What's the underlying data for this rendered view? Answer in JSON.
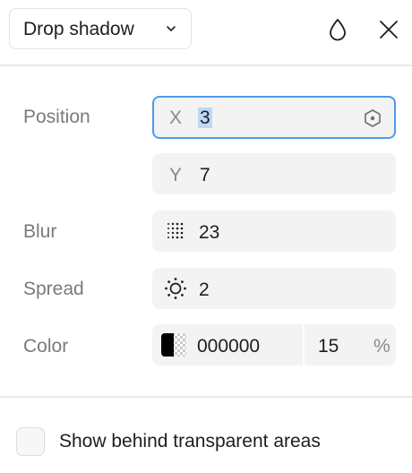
{
  "header": {
    "effect_type": "Drop shadow",
    "icons": {
      "dropdown": "chevron-down-icon",
      "fill": "drop-icon",
      "close": "close-icon"
    }
  },
  "position": {
    "label": "Position",
    "x_prefix": "X",
    "x_value": "3",
    "y_prefix": "Y",
    "y_value": "7"
  },
  "blur": {
    "label": "Blur",
    "value": "23",
    "icon": "blur-icon"
  },
  "spread": {
    "label": "Spread",
    "value": "2",
    "icon": "spread-icon"
  },
  "color": {
    "label": "Color",
    "hex": "000000",
    "opacity": "15",
    "opacity_unit": "%",
    "swatch": "#000000"
  },
  "footer": {
    "show_behind_label": "Show behind transparent areas",
    "checked": false
  },
  "colors": {
    "accent": "#4c9be8",
    "selection": "#bcd9f7",
    "field_bg": "#f3f3f3"
  }
}
